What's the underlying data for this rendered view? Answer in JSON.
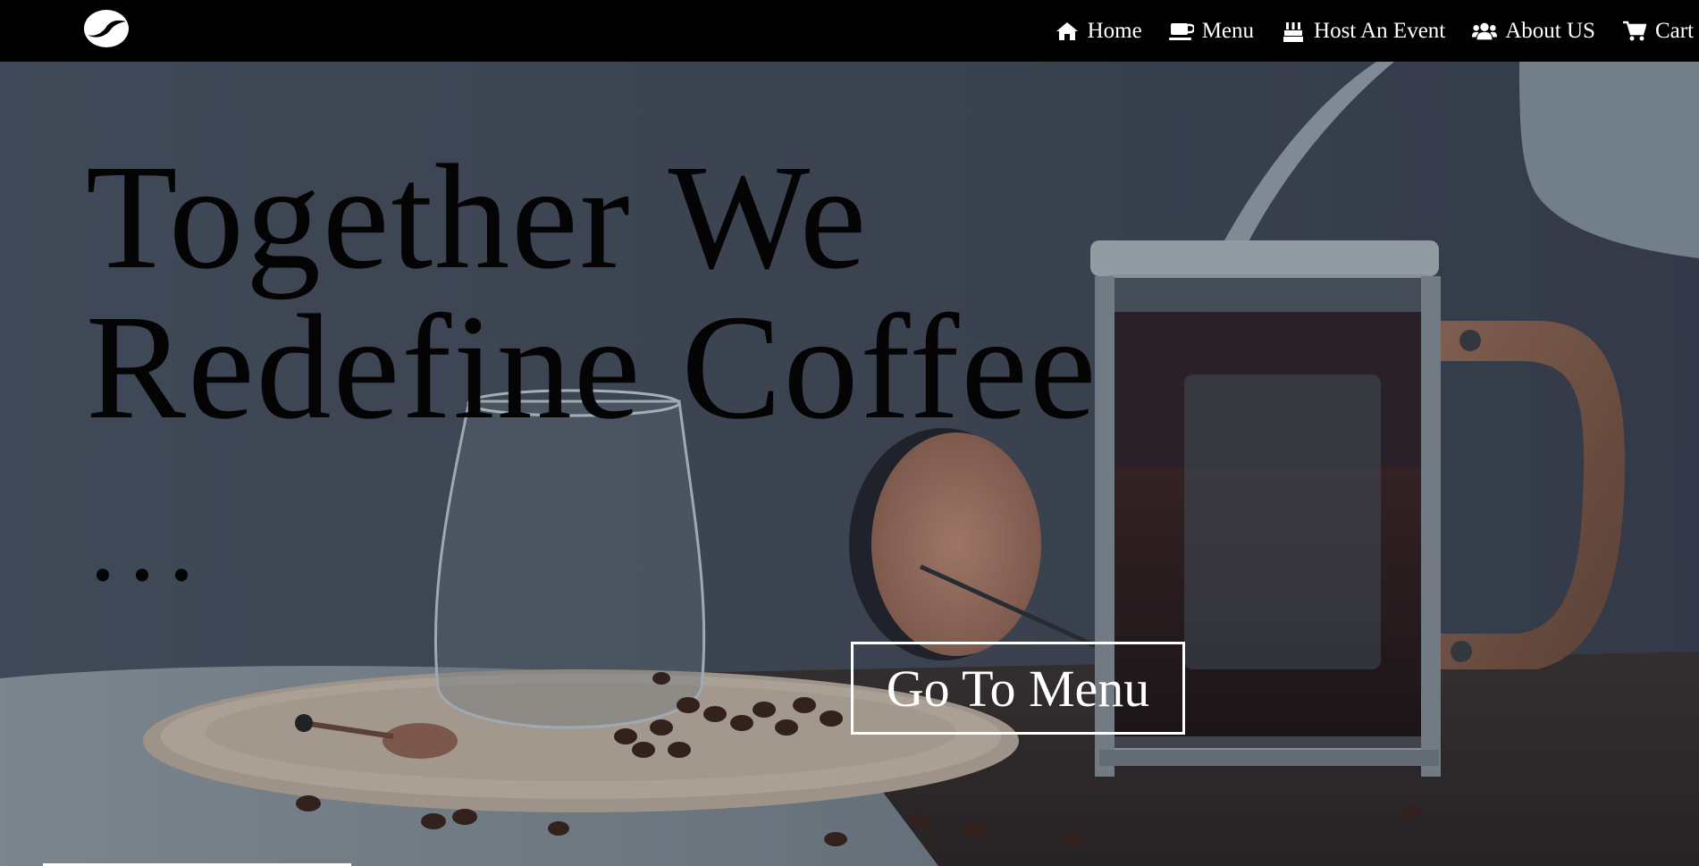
{
  "nav": {
    "logo_icon": "coffee-bean-icon",
    "items": [
      {
        "label": "Home",
        "icon": "home-icon"
      },
      {
        "label": "Menu",
        "icon": "coffee-cup-icon"
      },
      {
        "label": "Host An Event",
        "icon": "birthday-cake-icon"
      },
      {
        "label": "About US",
        "icon": "users-icon"
      },
      {
        "label": "Cart",
        "icon": "shopping-cart-icon"
      }
    ]
  },
  "hero": {
    "title_line1": "Together We",
    "title_line2": "Redefine Coffee",
    "ellipsis": "...",
    "cta_label": "Go To Menu"
  },
  "colors": {
    "navbar_bg": "#000000",
    "nav_text": "#ffffff",
    "hero_title": "#040404",
    "cta_border": "#ffffff"
  }
}
